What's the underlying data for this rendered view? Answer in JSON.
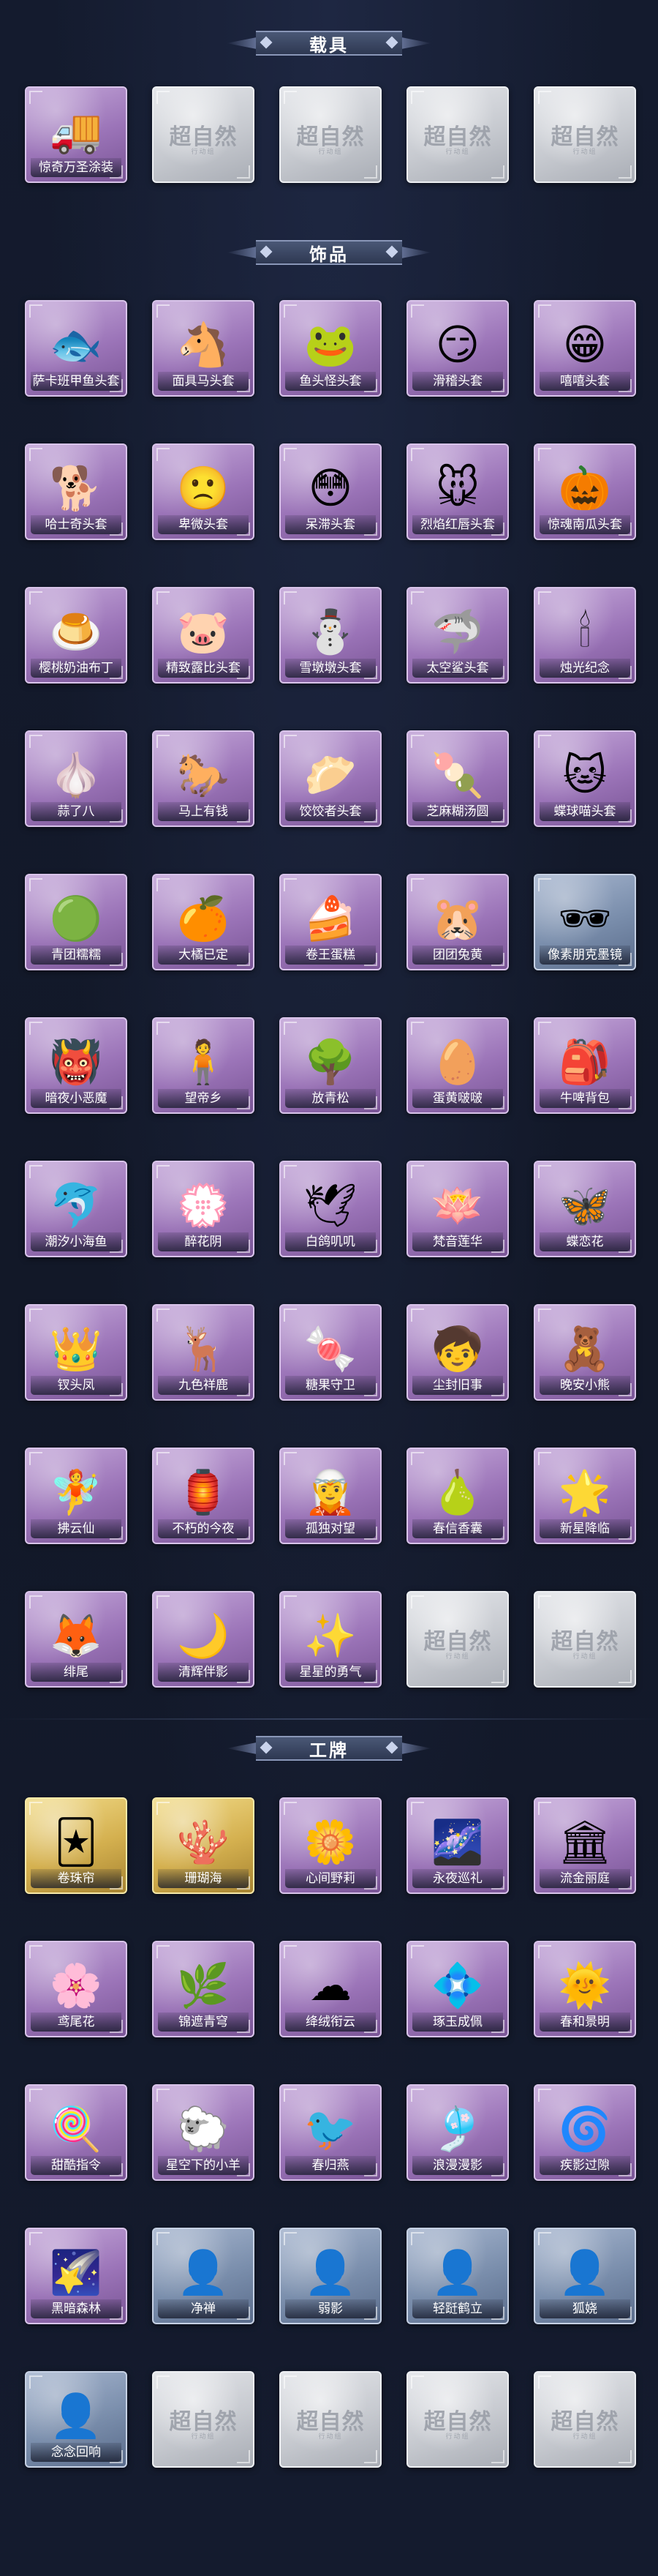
{
  "brand": {
    "logo_main": "超自然",
    "logo_sub": "行动组"
  },
  "sections": [
    {
      "title": "载具",
      "items": [
        {
          "label": "惊奇万圣涂装",
          "icon": "truck-icon",
          "glyph": "🚚",
          "style": "purple"
        },
        {
          "label": "",
          "icon": "empty-slot",
          "glyph": "",
          "style": "empty"
        },
        {
          "label": "",
          "icon": "empty-slot",
          "glyph": "",
          "style": "empty"
        },
        {
          "label": "",
          "icon": "empty-slot",
          "glyph": "",
          "style": "empty"
        },
        {
          "label": "",
          "icon": "empty-slot",
          "glyph": "",
          "style": "empty"
        }
      ]
    },
    {
      "title": "饰品",
      "items": [
        {
          "label": "萨卡班甲鱼头套",
          "icon": "fish-head-icon",
          "glyph": "🐟",
          "style": "purple"
        },
        {
          "label": "面具马头套",
          "icon": "horse-head-icon",
          "glyph": "🐴",
          "style": "purple"
        },
        {
          "label": "鱼头怪头套",
          "icon": "fish-monster-icon",
          "glyph": "🐸",
          "style": "purple"
        },
        {
          "label": "滑稽头套",
          "icon": "funny-face-icon",
          "glyph": "😏",
          "style": "purple"
        },
        {
          "label": "嘻嘻头套",
          "icon": "grin-face-icon",
          "glyph": "😁",
          "style": "purple"
        },
        {
          "label": "哈士奇头套",
          "icon": "husky-icon",
          "glyph": "🐕",
          "style": "purple"
        },
        {
          "label": "卑微头套",
          "icon": "humble-face-icon",
          "glyph": "🙁",
          "style": "purple"
        },
        {
          "label": "呆滞头套",
          "icon": "dazed-face-icon",
          "glyph": "😳",
          "style": "purple"
        },
        {
          "label": "烈焰红唇头套",
          "icon": "pikachu-icon",
          "glyph": "🐭",
          "style": "purple"
        },
        {
          "label": "惊魂南瓜头套",
          "icon": "pumpkin-icon",
          "glyph": "🎃",
          "style": "purple"
        },
        {
          "label": "樱桃奶油布丁",
          "icon": "pudding-icon",
          "glyph": "🍮",
          "style": "purple"
        },
        {
          "label": "精致露比头套",
          "icon": "pink-bird-icon",
          "glyph": "🐷",
          "style": "purple"
        },
        {
          "label": "雪墩墩头套",
          "icon": "snowman-icon",
          "glyph": "⛄",
          "style": "purple"
        },
        {
          "label": "太空鲨头套",
          "icon": "shark-icon",
          "glyph": "🦈",
          "style": "purple"
        },
        {
          "label": "烛光纪念",
          "icon": "candle-icon",
          "glyph": "🕯",
          "style": "purple"
        },
        {
          "label": "蒜了八",
          "icon": "garlic-icon",
          "glyph": "🧄",
          "style": "purple"
        },
        {
          "label": "马上有钱",
          "icon": "red-horse-icon",
          "glyph": "🐎",
          "style": "purple"
        },
        {
          "label": "饺饺者头套",
          "icon": "dumpling-icon",
          "glyph": "🥟",
          "style": "purple"
        },
        {
          "label": "芝麻糊汤圆",
          "icon": "rice-ball-icon",
          "glyph": "🍡",
          "style": "purple"
        },
        {
          "label": "蝶球喵头套",
          "icon": "cat-head-icon",
          "glyph": "🐱",
          "style": "purple"
        },
        {
          "label": "青团糯糯",
          "icon": "green-dumpling-icon",
          "glyph": "🟢",
          "style": "purple"
        },
        {
          "label": "大橘已定",
          "icon": "orange-icon",
          "glyph": "🍊",
          "style": "purple"
        },
        {
          "label": "卷王蛋糕",
          "icon": "cake-roll-icon",
          "glyph": "🍰",
          "style": "purple"
        },
        {
          "label": "团团兔黄",
          "icon": "bun-icon",
          "glyph": "🐹",
          "style": "purple"
        },
        {
          "label": "像素朋克墨镜",
          "icon": "pixel-glasses-icon",
          "glyph": "🕶",
          "style": "blue"
        },
        {
          "label": "暗夜小恶魔",
          "icon": "devil-girl-icon",
          "glyph": "👹",
          "style": "purple"
        },
        {
          "label": "望帝乡",
          "icon": "emperor-figure-icon",
          "glyph": "🧍",
          "style": "purple"
        },
        {
          "label": "放青松",
          "icon": "pine-tree-icon",
          "glyph": "🌳",
          "style": "purple"
        },
        {
          "label": "蛋黄啵啵",
          "icon": "egg-yolk-icon",
          "glyph": "🥚",
          "style": "purple"
        },
        {
          "label": "牛啤背包",
          "icon": "backpack-icon",
          "glyph": "🎒",
          "style": "purple"
        },
        {
          "label": "潮汐小海鱼",
          "icon": "sea-fish-icon",
          "glyph": "🐬",
          "style": "purple"
        },
        {
          "label": "醉花阴",
          "icon": "flower-hairpin-icon",
          "glyph": "💮",
          "style": "purple"
        },
        {
          "label": "白鸽叽叽",
          "icon": "white-dove-icon",
          "glyph": "🕊",
          "style": "purple"
        },
        {
          "label": "梵音莲华",
          "icon": "lotus-doll-icon",
          "glyph": "🪷",
          "style": "purple"
        },
        {
          "label": "蝶恋花",
          "icon": "butterfly-crown-icon",
          "glyph": "🦋",
          "style": "purple"
        },
        {
          "label": "钗头凤",
          "icon": "phoenix-crown-icon",
          "glyph": "👑",
          "style": "purple"
        },
        {
          "label": "九色祥鹿",
          "icon": "deer-charm-icon",
          "glyph": "🦌",
          "style": "purple"
        },
        {
          "label": "糖果守卫",
          "icon": "candy-guard-icon",
          "glyph": "🍬",
          "style": "purple"
        },
        {
          "label": "尘封旧事",
          "icon": "boy-charm-icon",
          "glyph": "🧒",
          "style": "purple"
        },
        {
          "label": "晚安小熊",
          "icon": "bear-charm-icon",
          "glyph": "🧸",
          "style": "purple"
        },
        {
          "label": "拂云仙",
          "icon": "fairy-charm-icon",
          "glyph": "🧚",
          "style": "purple"
        },
        {
          "label": "不朽的今夜",
          "icon": "pink-lantern-icon",
          "glyph": "🏮",
          "style": "purple"
        },
        {
          "label": "孤独对望",
          "icon": "lonely-doll-icon",
          "glyph": "🧝",
          "style": "purple"
        },
        {
          "label": "春信香囊",
          "icon": "sachet-icon",
          "glyph": "🍐",
          "style": "purple"
        },
        {
          "label": "新星降临",
          "icon": "star-doll-icon",
          "glyph": "🌟",
          "style": "purple"
        },
        {
          "label": "绯尾",
          "icon": "fox-doll-icon",
          "glyph": "🦊",
          "style": "purple"
        },
        {
          "label": "清辉伴影",
          "icon": "moon-doll-icon",
          "glyph": "🌙",
          "style": "purple"
        },
        {
          "label": "星星的勇气",
          "icon": "star-courage-icon",
          "glyph": "✨",
          "style": "purple"
        },
        {
          "label": "",
          "icon": "empty-slot",
          "glyph": "",
          "style": "empty"
        },
        {
          "label": "",
          "icon": "empty-slot",
          "glyph": "",
          "style": "empty"
        }
      ]
    },
    {
      "title": "工牌",
      "items": [
        {
          "label": "卷珠帘",
          "icon": "badge-ruby-icon",
          "glyph": "🃏",
          "style": "gold"
        },
        {
          "label": "珊瑚海",
          "icon": "badge-coral-icon",
          "glyph": "🪸",
          "style": "gold"
        },
        {
          "label": "心间野莉",
          "icon": "badge-meadow-icon",
          "glyph": "🌼",
          "style": "purple"
        },
        {
          "label": "永夜巡礼",
          "icon": "badge-night-icon",
          "glyph": "🌌",
          "style": "purple"
        },
        {
          "label": "流金丽庭",
          "icon": "badge-golden-icon",
          "glyph": "🏛",
          "style": "purple"
        },
        {
          "label": "鸢尾花",
          "icon": "badge-iris-icon",
          "glyph": "🌸",
          "style": "purple"
        },
        {
          "label": "锦遮青穹",
          "icon": "badge-sky-icon",
          "glyph": "🌿",
          "style": "purple"
        },
        {
          "label": "绛绒衔云",
          "icon": "badge-cloud-icon",
          "glyph": "☁",
          "style": "purple"
        },
        {
          "label": "琢玉成佩",
          "icon": "badge-jade-icon",
          "glyph": "💠",
          "style": "purple"
        },
        {
          "label": "春和景明",
          "icon": "badge-spring-icon",
          "glyph": "🌞",
          "style": "purple"
        },
        {
          "label": "甜酷指令",
          "icon": "badge-sweet-icon",
          "glyph": "🍭",
          "style": "purple"
        },
        {
          "label": "星空下的小羊",
          "icon": "badge-sheep-icon",
          "glyph": "🐑",
          "style": "purple"
        },
        {
          "label": "春归燕",
          "icon": "badge-swallow-icon",
          "glyph": "🐦",
          "style": "purple"
        },
        {
          "label": "浪漫漫影",
          "icon": "badge-romance-icon",
          "glyph": "🎐",
          "style": "purple"
        },
        {
          "label": "疾影过隙",
          "icon": "badge-shadow-icon",
          "glyph": "🌀",
          "style": "purple"
        },
        {
          "label": "黑暗森林",
          "icon": "badge-forest-icon",
          "glyph": "🌠",
          "style": "purple"
        },
        {
          "label": "净禅",
          "icon": "silhouette-icon",
          "glyph": "👤",
          "style": "blue"
        },
        {
          "label": "弱影",
          "icon": "silhouette-icon",
          "glyph": "👤",
          "style": "blue"
        },
        {
          "label": "轻跹鹤立",
          "icon": "silhouette-icon",
          "glyph": "👤",
          "style": "blue"
        },
        {
          "label": "狐娆",
          "icon": "silhouette-icon",
          "glyph": "👤",
          "style": "blue"
        },
        {
          "label": "念念回响",
          "icon": "silhouette-icon",
          "glyph": "👤",
          "style": "blue"
        },
        {
          "label": "",
          "icon": "empty-slot",
          "glyph": "",
          "style": "empty"
        },
        {
          "label": "",
          "icon": "empty-slot",
          "glyph": "",
          "style": "empty"
        },
        {
          "label": "",
          "icon": "empty-slot",
          "glyph": "",
          "style": "empty"
        },
        {
          "label": "",
          "icon": "empty-slot",
          "glyph": "",
          "style": "empty"
        }
      ]
    }
  ]
}
